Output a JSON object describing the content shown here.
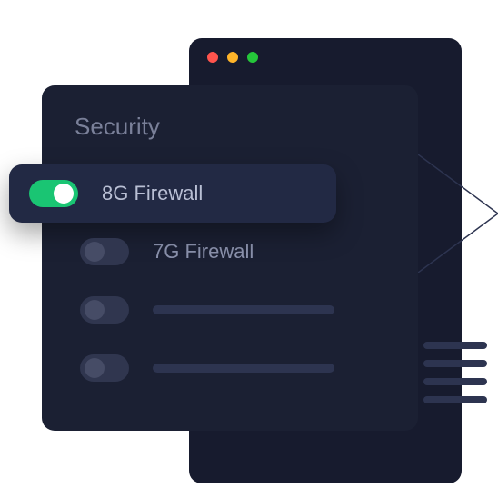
{
  "panel": {
    "title": "Security",
    "items": [
      {
        "label": "8G Firewall",
        "enabled": true
      },
      {
        "label": "7G Firewall",
        "enabled": false
      }
    ]
  },
  "colors": {
    "accent": "#1ac573",
    "panel_bg": "#1b2033",
    "active_row_bg": "#222944"
  }
}
